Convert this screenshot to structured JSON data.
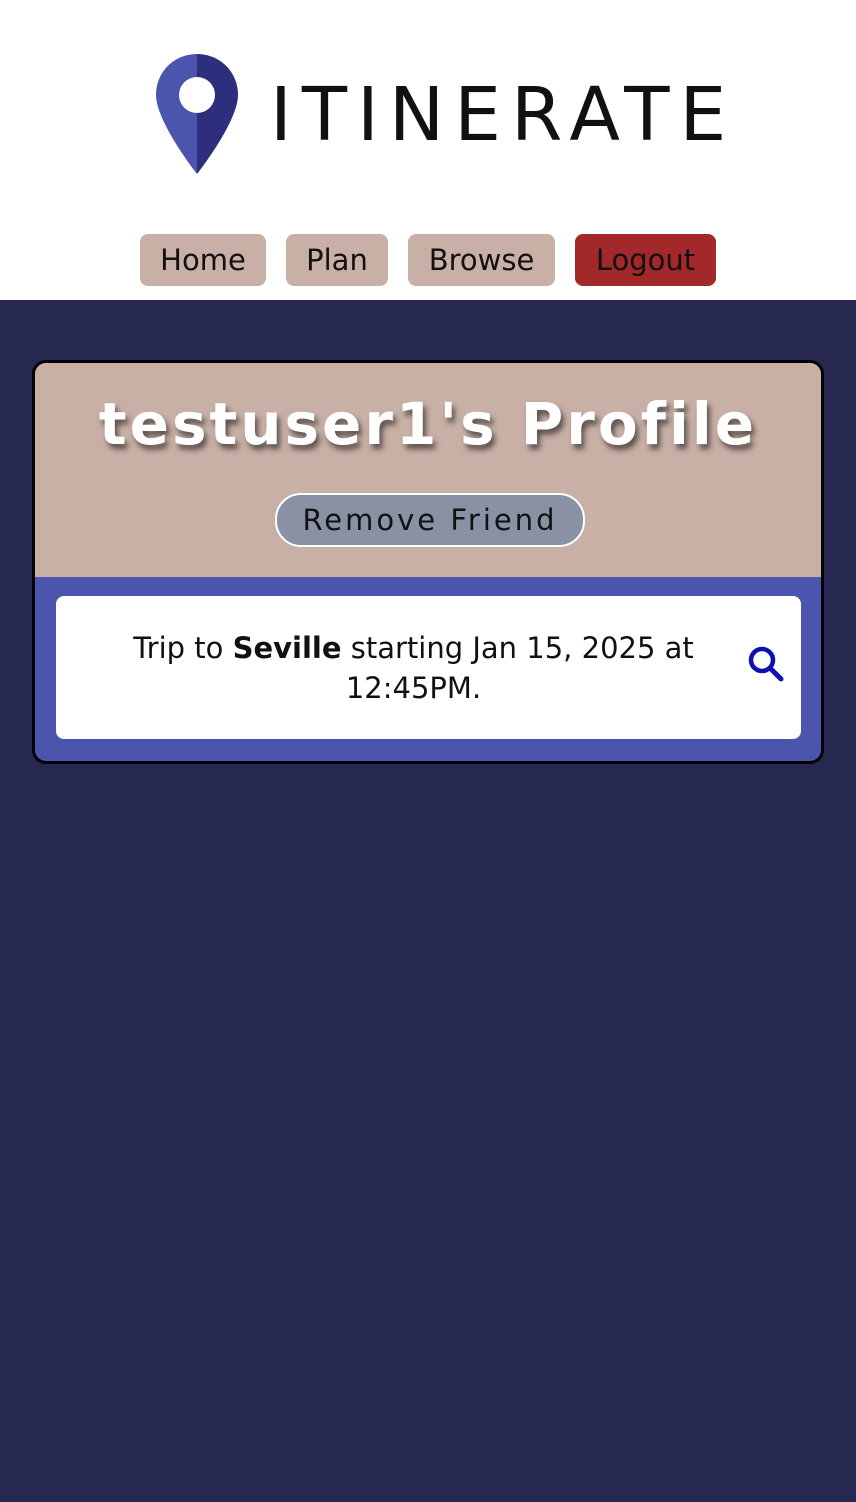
{
  "brand": {
    "name": "ITINERATE",
    "logo_icon": "map-pin-icon",
    "pin_color_light": "#4b55ae",
    "pin_color_dark": "#2d2f7e"
  },
  "nav": {
    "items": [
      {
        "label": "Home"
      },
      {
        "label": "Plan"
      },
      {
        "label": "Browse"
      },
      {
        "label": "Logout"
      }
    ]
  },
  "profile": {
    "title": "testuser1's Profile",
    "remove_friend_label": "Remove Friend"
  },
  "trips": [
    {
      "prefix": "Trip to ",
      "destination": "Seville",
      "middle": " starting ",
      "date": "Jan 15, 2025",
      "at": " at ",
      "time": "12:45PM",
      "suffix": ".",
      "action_icon": "search-icon"
    }
  ],
  "colors": {
    "background": "#262851",
    "nav_button": "#c8b0a6",
    "logout_button": "#a3282a",
    "card_header": "#c8b0a6",
    "card_body": "#4b55ae",
    "remove_button": "#8892a4",
    "search_icon": "#1010b0"
  }
}
